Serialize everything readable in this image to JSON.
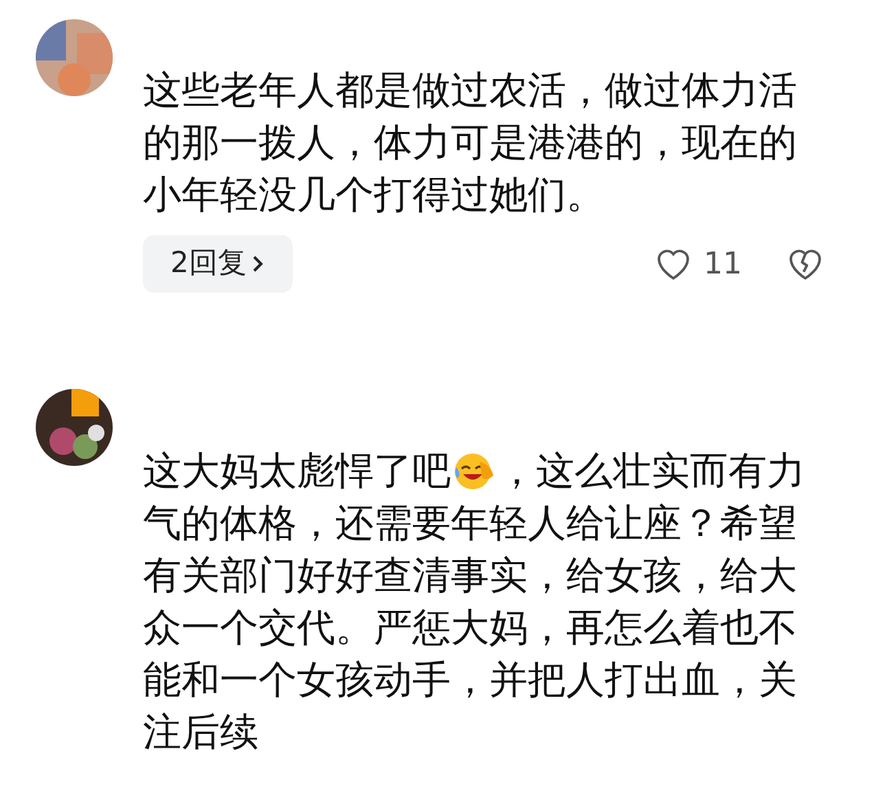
{
  "comments": [
    {
      "text": "这些老年人都是做过农活，做过体力活的那一拨人，体力可是港港的，现在的小年轻没几个打得过她们。",
      "replies": "2回复",
      "likes": "11"
    },
    {
      "first_line": [
        {
          "kind": "text",
          "text": "这大妈太彪悍了吧"
        },
        {
          "kind": "emoji"
        },
        {
          "kind": "text",
          "text": "，这么壮实而有力"
        }
      ],
      "text": "气的体格，还需要年轻人给让座？希望有关部门好好查清事实，给女孩，给大众一个交代。严惩大妈，再怎么着也不能和一个女孩动手，并把人打出血，关注后续"
    }
  ]
}
